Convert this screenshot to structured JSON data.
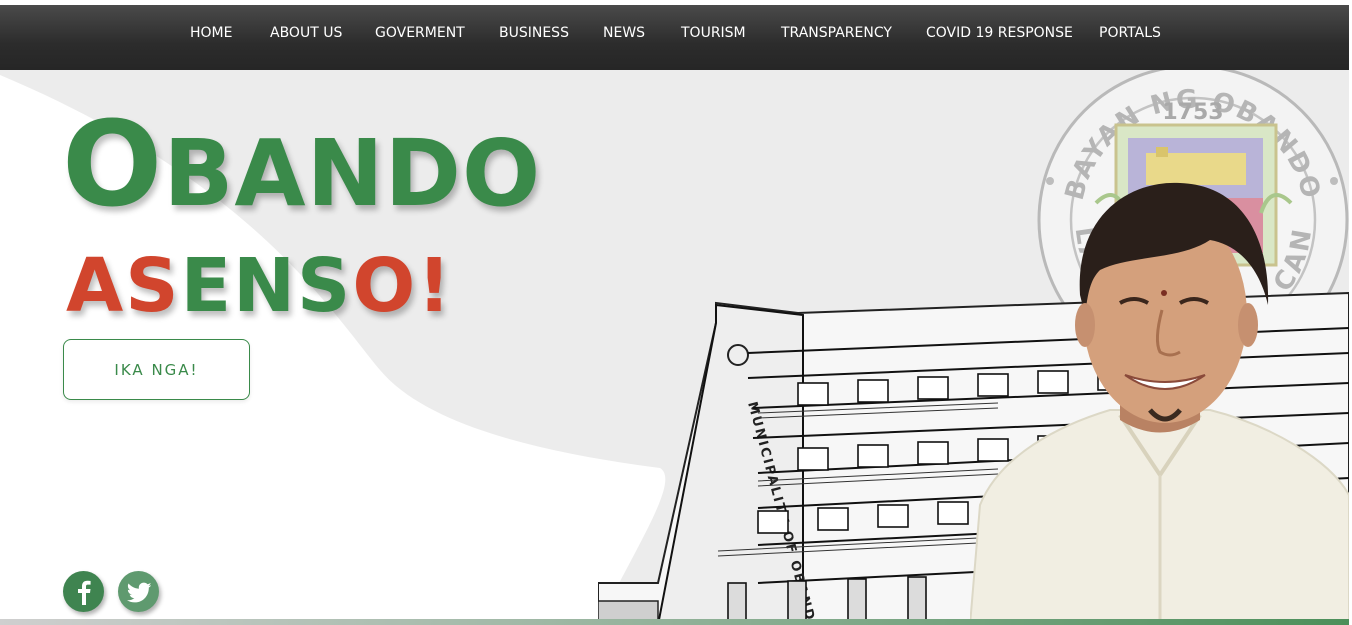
{
  "nav": {
    "items": [
      "HOME",
      "ABOUT US",
      "GOVERMENT",
      "BUSINESS",
      "NEWS",
      "TOURISM",
      "TRANSPARENCY",
      "COVID 19 RESPONSE",
      "PORTALS"
    ]
  },
  "hero": {
    "title_first_letter": "O",
    "title_rest": "BANDO",
    "subtitle_part1": "AS",
    "subtitle_part2": "ENS",
    "subtitle_part3": "O!",
    "cta_label": "IKA NGA!"
  },
  "seal": {
    "top_text": "BAYAN NG OBANDO",
    "year": "1753",
    "left_text": "LALA",
    "right_text": "CAN"
  },
  "building": {
    "facade_text": "MUNICIPALITY OF OBANDO"
  },
  "social": {
    "facebook_icon": "facebook-icon",
    "twitter_icon": "twitter-icon"
  },
  "colors": {
    "green": "#3a8a4a",
    "red": "#d1452d",
    "nav": "#2c2c2c"
  }
}
